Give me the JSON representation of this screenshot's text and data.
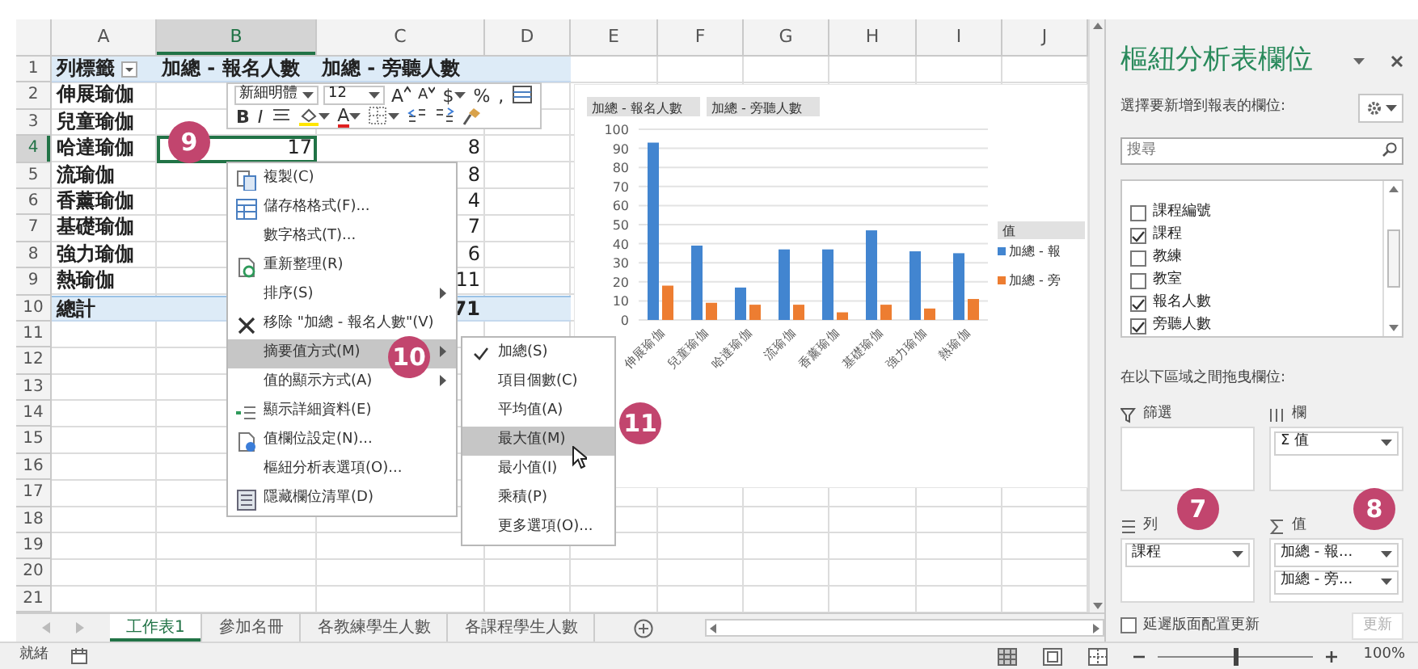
{
  "sheet": {
    "columns": [
      {
        "label": "A",
        "selected": false
      },
      {
        "label": "B",
        "selected": true
      },
      {
        "label": "C",
        "selected": false
      },
      {
        "label": "D",
        "selected": false
      },
      {
        "label": "E",
        "selected": false
      },
      {
        "label": "F",
        "selected": false
      },
      {
        "label": "G",
        "selected": false
      },
      {
        "label": "H",
        "selected": false
      },
      {
        "label": "I",
        "selected": false
      },
      {
        "label": "J",
        "selected": false
      }
    ],
    "rows": [
      {
        "label": "1",
        "selected": false
      },
      {
        "label": "2",
        "selected": false
      },
      {
        "label": "3",
        "selected": false
      },
      {
        "label": "4",
        "selected": true
      },
      {
        "label": "5",
        "selected": false
      },
      {
        "label": "6",
        "selected": false
      },
      {
        "label": "7",
        "selected": false
      },
      {
        "label": "8",
        "selected": false
      },
      {
        "label": "9",
        "selected": false
      },
      {
        "label": "10",
        "selected": false
      },
      {
        "label": "11",
        "selected": false
      },
      {
        "label": "12",
        "selected": false
      },
      {
        "label": "13",
        "selected": false
      },
      {
        "label": "14",
        "selected": false
      },
      {
        "label": "15",
        "selected": false
      },
      {
        "label": "16",
        "selected": false
      },
      {
        "label": "17",
        "selected": false
      },
      {
        "label": "18",
        "selected": false
      },
      {
        "label": "19",
        "selected": false
      },
      {
        "label": "20",
        "selected": false
      },
      {
        "label": "21",
        "selected": false
      }
    ],
    "pivot": {
      "header": {
        "label": "列標籤",
        "value_1": "加總 - 報名人數",
        "value_2": "加總 - 旁聽人數"
      },
      "rows": [
        {
          "label": "伸展瑜伽",
          "selected": false
        },
        {
          "label": "兒童瑜伽",
          "selected": false
        },
        {
          "label": "哈達瑜伽",
          "value_1": "17",
          "value_2": "8",
          "selected": true
        },
        {
          "label": "流瑜伽",
          "value_2": "8",
          "selected": false
        },
        {
          "label": "香薰瑜伽",
          "value_2": "4",
          "selected": false
        },
        {
          "label": "基礎瑜伽",
          "value_2": "7",
          "selected": false
        },
        {
          "label": "強力瑜伽",
          "value_2": "6",
          "selected": false
        },
        {
          "label": "熱瑜伽",
          "value_2": "11",
          "selected": false
        }
      ],
      "total": {
        "label": "總計",
        "value_2": "71"
      }
    }
  },
  "chart": {
    "chart_data": {
      "type": "bar",
      "categories": [
        "伸展瑜伽",
        "兒童瑜伽",
        "哈達瑜伽",
        "流瑜伽",
        "香薰瑜伽",
        "基礎瑜伽",
        "強力瑜伽",
        "熱瑜伽"
      ],
      "series": [
        {
          "name": "加總 - 報",
          "color": "#4285d0",
          "values": [
            93,
            39,
            17,
            37,
            37,
            47,
            36,
            35
          ]
        },
        {
          "name": "加總 - 旁",
          "color": "#ed7d31",
          "values": [
            18,
            9,
            8,
            8,
            4,
            8,
            6,
            11
          ]
        }
      ],
      "ylim": [
        0,
        100
      ],
      "yticks": [
        0,
        10,
        20,
        30,
        40,
        50,
        60,
        70,
        80,
        90,
        100
      ],
      "grid": true,
      "legend": "right"
    },
    "field_buttons": [
      "加總 - 報名人數",
      "加總 - 旁聽人數"
    ],
    "legend": {
      "title": "值"
    }
  },
  "mini_toolbar": {
    "font": "新細明體",
    "size": "12",
    "row_1": [
      {
        "kind": "grow",
        "label": "A"
      },
      {
        "kind": "shrink",
        "label": "A"
      },
      {
        "kind": "currency",
        "label": "$"
      },
      {
        "kind": "percent",
        "label": "%"
      },
      {
        "kind": "comma",
        "label": ","
      },
      {
        "kind": "format"
      }
    ],
    "row_2": [
      {
        "kind": "bold",
        "label": "B"
      },
      {
        "kind": "italic",
        "label": "I"
      },
      {
        "kind": "align"
      },
      {
        "kind": "fill"
      },
      {
        "kind": "font-color",
        "label": "A"
      },
      {
        "kind": "borders"
      },
      {
        "kind": "increase-decimal"
      },
      {
        "kind": "decrease-decimal"
      },
      {
        "kind": "painter"
      }
    ]
  },
  "context_menu": {
    "items": [
      {
        "kind": "copy",
        "label": "複製(C)",
        "submenu": false,
        "selected": false
      },
      {
        "kind": "cells",
        "label": "儲存格格式(F)...",
        "submenu": false,
        "selected": false
      },
      {
        "kind": "plain",
        "label": "數字格式(T)...",
        "submenu": false,
        "selected": false
      },
      {
        "kind": "refresh",
        "label": "重新整理(R)",
        "submenu": false,
        "selected": false
      },
      {
        "kind": "plain",
        "label": "排序(S)",
        "submenu": true,
        "selected": false
      },
      {
        "kind": "remove",
        "label": "移除 \"加總 - 報名人數\"(V)",
        "submenu": false,
        "selected": false
      },
      {
        "kind": "plain",
        "label": "摘要值方式(M)",
        "submenu": true,
        "selected": true
      },
      {
        "kind": "plain",
        "label": "值的顯示方式(A)",
        "submenu": true,
        "selected": false
      },
      {
        "kind": "details",
        "label": "顯示詳細資料(E)",
        "submenu": false,
        "selected": false
      },
      {
        "kind": "settings",
        "label": "值欄位設定(N)...",
        "submenu": false,
        "selected": false
      },
      {
        "kind": "plain",
        "label": "樞紐分析表選項(O)...",
        "submenu": false,
        "selected": false
      },
      {
        "kind": "list",
        "label": "隱藏欄位清單(D)",
        "submenu": false,
        "selected": false
      }
    ]
  },
  "submenu": {
    "items": [
      {
        "label": "加總(S)",
        "checked": true,
        "selected": false
      },
      {
        "label": "項目個數(C)",
        "checked": false,
        "selected": false
      },
      {
        "label": "平均值(A)",
        "checked": false,
        "selected": false
      },
      {
        "label": "最大值(M)",
        "checked": false,
        "selected": true
      },
      {
        "label": "最小值(I)",
        "checked": false,
        "selected": false
      },
      {
        "label": "乘積(P)",
        "checked": false,
        "selected": false
      },
      {
        "label": "更多選項(O)...",
        "checked": false,
        "selected": false
      }
    ]
  },
  "badges": [
    "9",
    "10",
    "11",
    "7",
    "8"
  ],
  "sheet_tabs": [
    {
      "label": "工作表1",
      "selected": true
    },
    {
      "label": "參加名冊",
      "selected": false
    },
    {
      "label": "各教練學生人數",
      "selected": false
    },
    {
      "label": "各課程學生人數",
      "selected": false
    }
  ],
  "status_bar": {
    "text": "就緒",
    "zoom": {
      "level": 0.5,
      "reading": "100%"
    }
  },
  "field_pane": {
    "title": "樞紐分析表欄位",
    "prompt": "選擇要新增到報表的欄位:",
    "search": {
      "placeholder": "搜尋"
    },
    "fields": [
      {
        "label": "課程編號",
        "checked": false
      },
      {
        "label": "課程",
        "checked": true
      },
      {
        "label": "教練",
        "checked": false
      },
      {
        "label": "教室",
        "checked": false
      },
      {
        "label": "報名人數",
        "checked": true
      },
      {
        "label": "旁聽人數",
        "checked": true
      }
    ],
    "areas_prompt": "在以下區域之間拖曳欄位:",
    "areas": [
      {
        "kind": "filter",
        "label": "篩選"
      },
      {
        "kind": "columns",
        "label": "欄",
        "chips": [
          "Σ 值"
        ]
      },
      {
        "kind": "rows",
        "label": "列",
        "chips": [
          "課程"
        ]
      },
      {
        "kind": "values",
        "label": "值",
        "chips": [
          "加總 - 報...",
          "加總 - 旁..."
        ]
      }
    ],
    "defer": {
      "label": "延遲版面配置更新",
      "checked": false
    },
    "update_button": {
      "label": "更新",
      "disabled": true
    }
  }
}
